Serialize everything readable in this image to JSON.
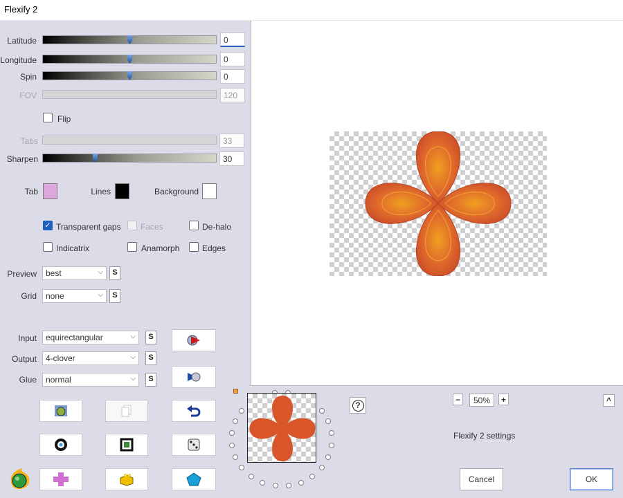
{
  "window": {
    "title": "Flexify 2"
  },
  "sliders": {
    "latitude": {
      "label": "Latitude",
      "value": "0"
    },
    "longitude": {
      "label": "Longitude",
      "value": "0"
    },
    "spin": {
      "label": "Spin",
      "value": "0"
    },
    "fov": {
      "label": "FOV",
      "value": "120"
    },
    "tabs": {
      "label": "Tabs",
      "value": "33"
    },
    "sharpen": {
      "label": "Sharpen",
      "value": "30"
    }
  },
  "flip": {
    "label": "Flip"
  },
  "colors": {
    "tab": {
      "label": "Tab",
      "color": "#dca8dc"
    },
    "lines": {
      "label": "Lines",
      "color": "#000000"
    },
    "background": {
      "label": "Background",
      "color": "#ffffff"
    }
  },
  "options": {
    "transparent_gaps": "Transparent gaps",
    "faces": "Faces",
    "dehalo": "De-halo",
    "indicatrix": "Indicatrix",
    "anamorph": "Anamorph",
    "edges": "Edges"
  },
  "preview_quality": {
    "label": "Preview",
    "value": "best"
  },
  "grid": {
    "label": "Grid",
    "value": "none"
  },
  "input": {
    "label": "Input",
    "value": "equirectangular"
  },
  "output": {
    "label": "Output",
    "value": "4-clover"
  },
  "glue": {
    "label": "Glue",
    "value": "normal"
  },
  "s_button": "S",
  "help_button": "?",
  "zoom": {
    "minus": "−",
    "value": "50%",
    "plus": "+"
  },
  "collapse_button": "^",
  "settings_name": "Flexify 2 settings",
  "cancel_label": "Cancel",
  "ok_label": "OK",
  "accent_color": "#1f5fbf",
  "clover_color": "#d8562a"
}
